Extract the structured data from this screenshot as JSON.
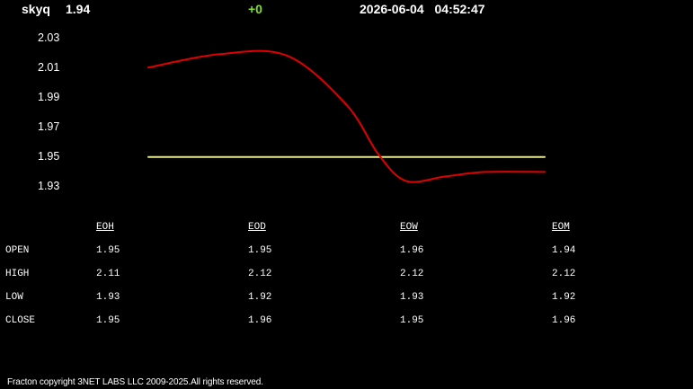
{
  "header": {
    "symbol": "skyq",
    "price": "1.94",
    "change": "+0",
    "datetime": "2026-06-04   04:52:47"
  },
  "colors": {
    "background": "#000000",
    "text": "#ffffff",
    "change_positive": "#7fe02a",
    "price_line": "#e00000",
    "reference_line": "#e6ea8c"
  },
  "chart_data": {
    "type": "line",
    "ylim": [
      1.93,
      2.03
    ],
    "yticks": [
      "2.03",
      "2.01",
      "1.99",
      "1.97",
      "1.95",
      "1.93"
    ],
    "grid": false,
    "series": [
      {
        "color": "#e00000",
        "x": [
          0,
          0.18,
          0.35,
          0.5,
          0.58,
          0.65,
          0.75,
          0.85,
          1.0
        ],
        "values": [
          2.01,
          2.019,
          2.018,
          1.985,
          1.952,
          1.934,
          1.937,
          1.94,
          1.94
        ]
      },
      {
        "color": "#e6ea8c",
        "x": [
          0,
          1
        ],
        "values": [
          1.95,
          1.95
        ]
      }
    ]
  },
  "table": {
    "columns": [
      "EOH",
      "EOD",
      "EOW",
      "EOM"
    ],
    "rows": [
      {
        "label": "OPEN",
        "values": [
          "1.95",
          "1.95",
          "1.96",
          "1.94"
        ]
      },
      {
        "label": "HIGH",
        "values": [
          "2.11",
          "2.12",
          "2.12",
          "2.12"
        ]
      },
      {
        "label": "LOW",
        "values": [
          "1.93",
          "1.92",
          "1.93",
          "1.92"
        ]
      },
      {
        "label": "CLOSE",
        "values": [
          "1.95",
          "1.96",
          "1.95",
          "1.96"
        ]
      }
    ]
  },
  "footer": {
    "copyright": "Fracton copyright 3NET LABS LLC 2009-2025.All rights reserved."
  }
}
